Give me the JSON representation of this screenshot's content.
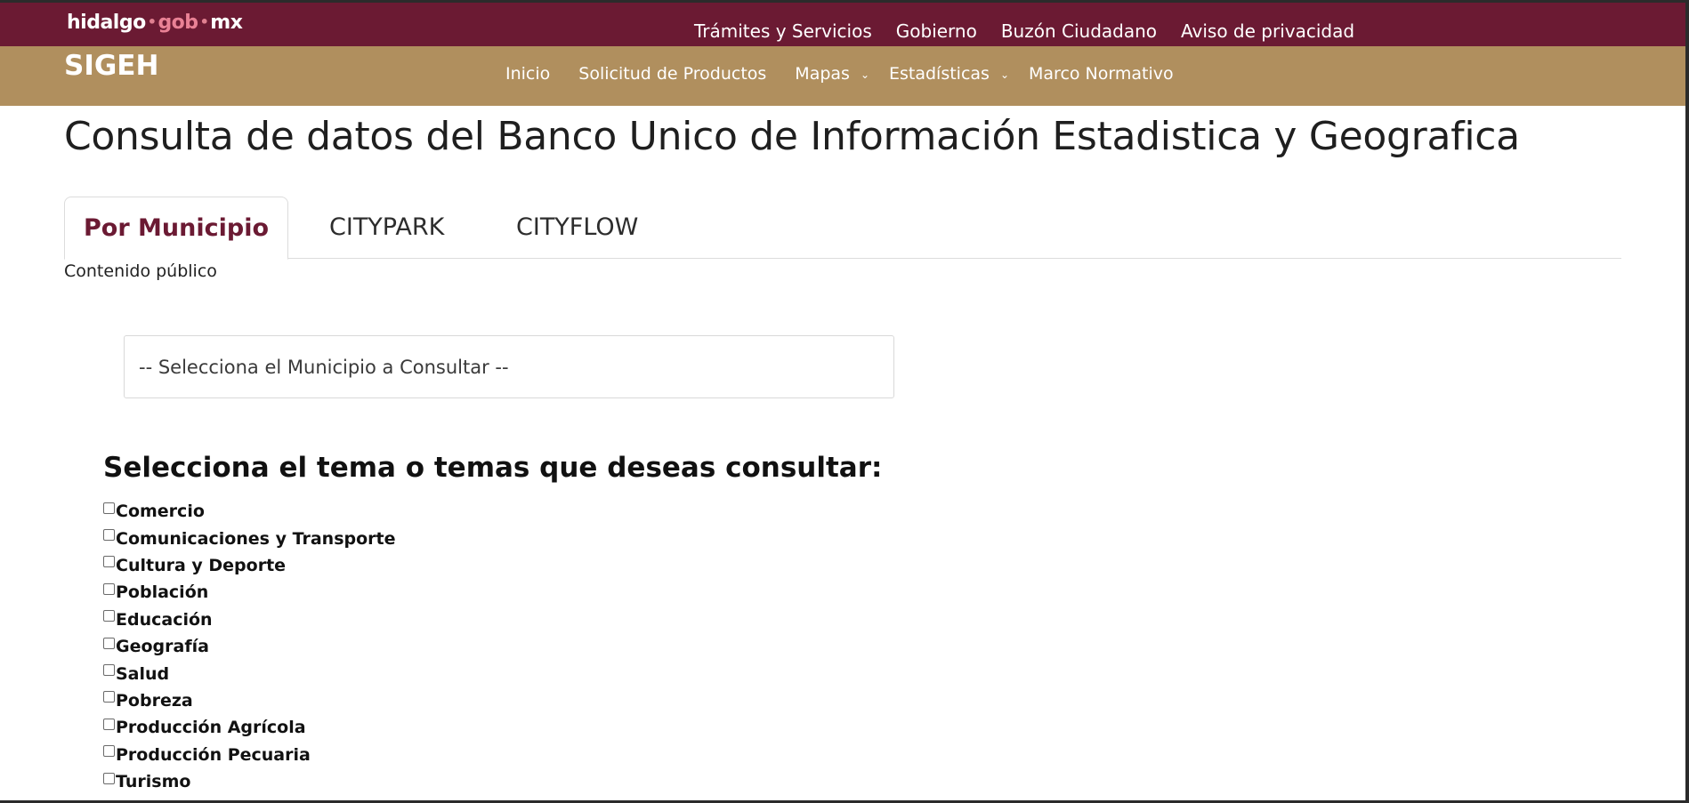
{
  "brand": {
    "part1": "hidalgo",
    "part2": "gob",
    "part3": "mx",
    "sep": "•"
  },
  "top_nav": [
    "Trámites y Servicios",
    "Gobierno",
    "Buzón Ciudadano",
    "Aviso de privacidad"
  ],
  "site_logo": "SIGEH",
  "main_nav": [
    {
      "label": "Inicio",
      "dropdown": false
    },
    {
      "label": "Solicitud de Productos",
      "dropdown": false
    },
    {
      "label": "Mapas",
      "dropdown": true
    },
    {
      "label": "Estadísticas",
      "dropdown": true
    },
    {
      "label": "Marco Normativo",
      "dropdown": false
    }
  ],
  "page_title": "Consulta de datos del Banco Unico de Información Estadistica y Geografica",
  "tabs": [
    {
      "label": "Por Municipio",
      "active": true
    },
    {
      "label": "CITYPARK",
      "active": false
    },
    {
      "label": "CITYFLOW",
      "active": false
    }
  ],
  "public_note": "Contenido público",
  "municipio_select": {
    "selected": "-- Selecciona el Municipio a Consultar --"
  },
  "topics_heading": "Selecciona el tema o temas que deseas consultar:",
  "topics": [
    {
      "label": "Comercio",
      "checked": false
    },
    {
      "label": "Comunicaciones y Transporte",
      "checked": false
    },
    {
      "label": "Cultura y Deporte",
      "checked": false
    },
    {
      "label": "Población",
      "checked": false
    },
    {
      "label": "Educación",
      "checked": false
    },
    {
      "label": "Geografía",
      "checked": false
    },
    {
      "label": "Salud",
      "checked": false
    },
    {
      "label": "Pobreza",
      "checked": false
    },
    {
      "label": "Producción Agrícola",
      "checked": false
    },
    {
      "label": "Producción Pecuaria",
      "checked": false
    },
    {
      "label": "Turismo",
      "checked": false
    }
  ],
  "colors": {
    "topbar": "#6b1a33",
    "secbar": "#b08f5e",
    "active_tab": "#6b1a33"
  }
}
